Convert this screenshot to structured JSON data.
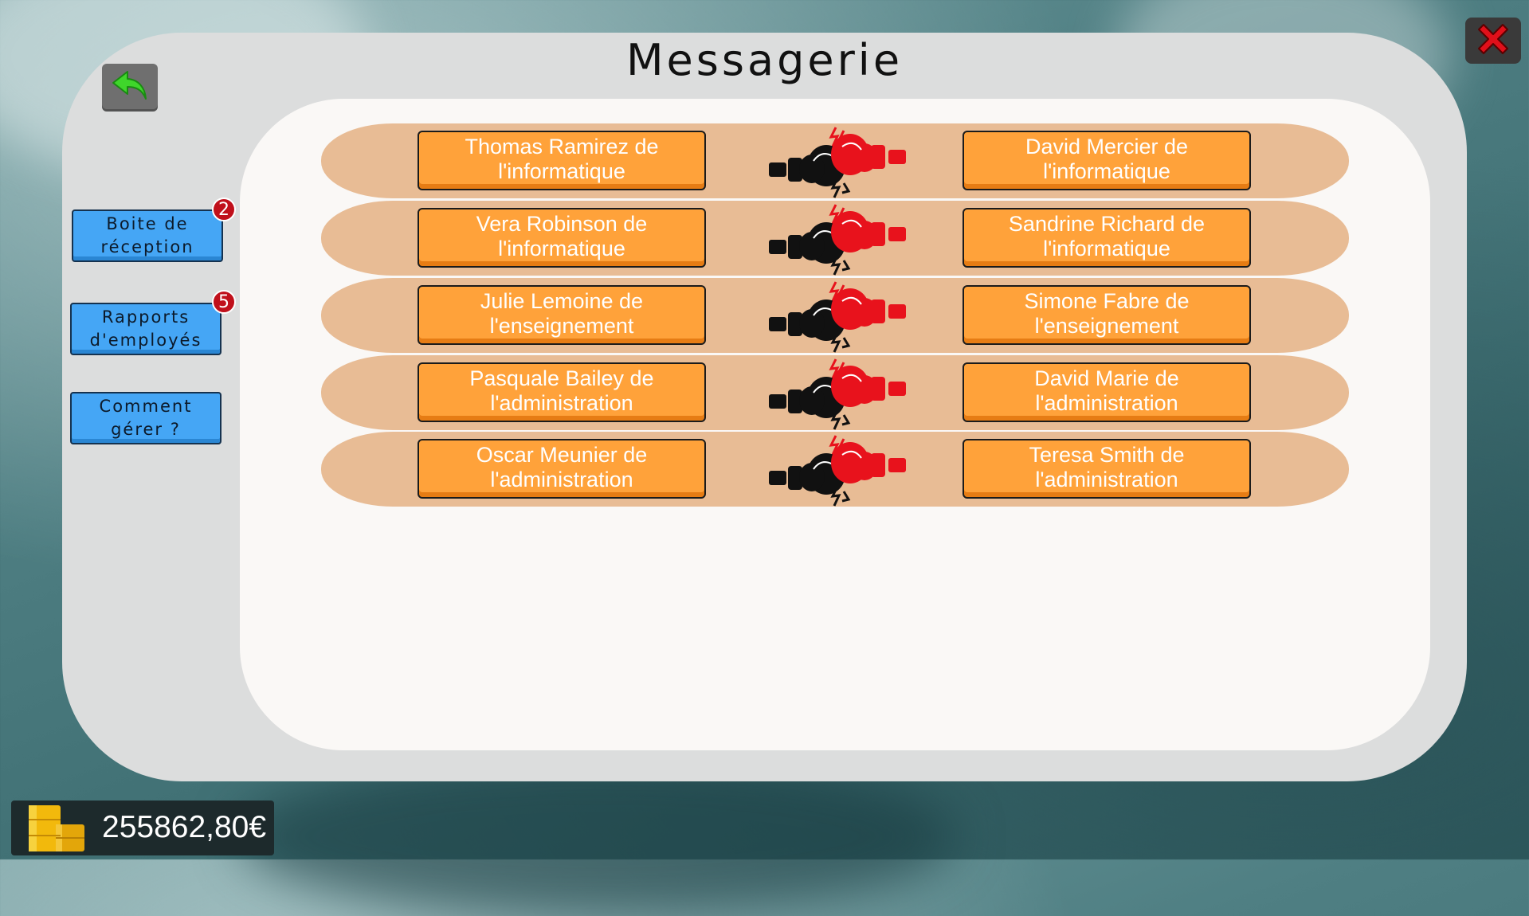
{
  "window": {
    "title": "Messagerie",
    "back_icon": "back-arrow-icon",
    "close_icon": "close-x-icon"
  },
  "sidebar": [
    {
      "label": "Boite de réception",
      "badge": "2"
    },
    {
      "label": "Rapports d'employés",
      "badge": "5"
    },
    {
      "label": "Comment gérer ?",
      "badge": ""
    }
  ],
  "conflicts": [
    {
      "left": "Thomas Ramirez de l'informatique",
      "right": "David Mercier de l'informatique"
    },
    {
      "left": "Vera Robinson de l'informatique",
      "right": "Sandrine Richard de l'informatique"
    },
    {
      "left": "Julie Lemoine de l'enseignement",
      "right": "Simone Fabre de l'enseignement"
    },
    {
      "left": "Pasquale Bailey de l'administration",
      "right": "David Marie de l'administration"
    },
    {
      "left": "Oscar Meunier de l'administration",
      "right": "Teresa Smith de l'administration"
    }
  ],
  "footer": {
    "money": "255862,80€",
    "coins_icon": "gold-coins-icon"
  },
  "colors": {
    "button_orange": "#ffa23a",
    "row_tan": "#e8bc95",
    "side_blue": "#45a6f5",
    "badge_red": "#c0101b",
    "glove_red": "#e8121c"
  }
}
